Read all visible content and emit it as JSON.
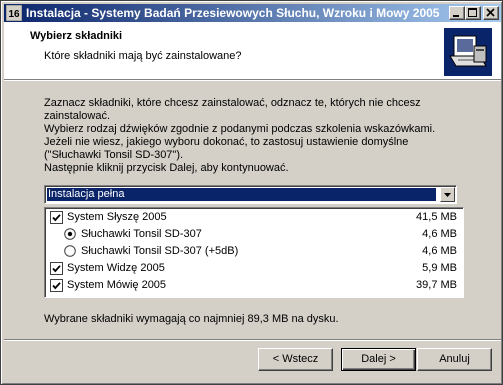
{
  "window": {
    "title": "Instalacja - Systemy Badań Przesiewowych Słuchu, Wzroku i Mowy 2005",
    "app_icon_text": "16"
  },
  "header": {
    "title": "Wybierz składniki",
    "subtitle": "Które składniki mają być zainstalowane?"
  },
  "instructions": {
    "line1": "Zaznacz składniki, które chcesz zainstalować, odznacz te, których nie chcesz zainstalować.",
    "line2": "Wybierz rodzaj dźwięków zgodnie z podanymi podczas szkolenia wskazówkami. Jeżeli nie wiesz, jakiego wyboru dokonać, to zastosuj ustawienie domyślne (\"Słuchawki Tonsil SD-307\").",
    "line3": "Następnie kliknij przycisk Dalej, aby kontynuować."
  },
  "install_type": {
    "selected": "Instalacja pełna"
  },
  "components": [
    {
      "label": "System Słyszę 2005",
      "size": "41,5 MB",
      "kind": "checkbox",
      "checked": true,
      "indent": 0
    },
    {
      "label": "Słuchawki Tonsil SD-307",
      "size": "4,6 MB",
      "kind": "radio",
      "checked": true,
      "indent": 1
    },
    {
      "label": "Słuchawki Tonsil SD-307 (+5dB)",
      "size": "4,6 MB",
      "kind": "radio",
      "checked": false,
      "indent": 1
    },
    {
      "label": "System Widzę 2005",
      "size": "5,9 MB",
      "kind": "checkbox",
      "checked": true,
      "indent": 0
    },
    {
      "label": "System Mówię 2005",
      "size": "39,7 MB",
      "kind": "checkbox",
      "checked": true,
      "indent": 0
    }
  ],
  "required_space": "Wybrane składniki wymagają co najmniej 89,3 MB na dysku.",
  "buttons": {
    "back": "< Wstecz",
    "next": "Dalej >",
    "cancel": "Anuluj"
  }
}
